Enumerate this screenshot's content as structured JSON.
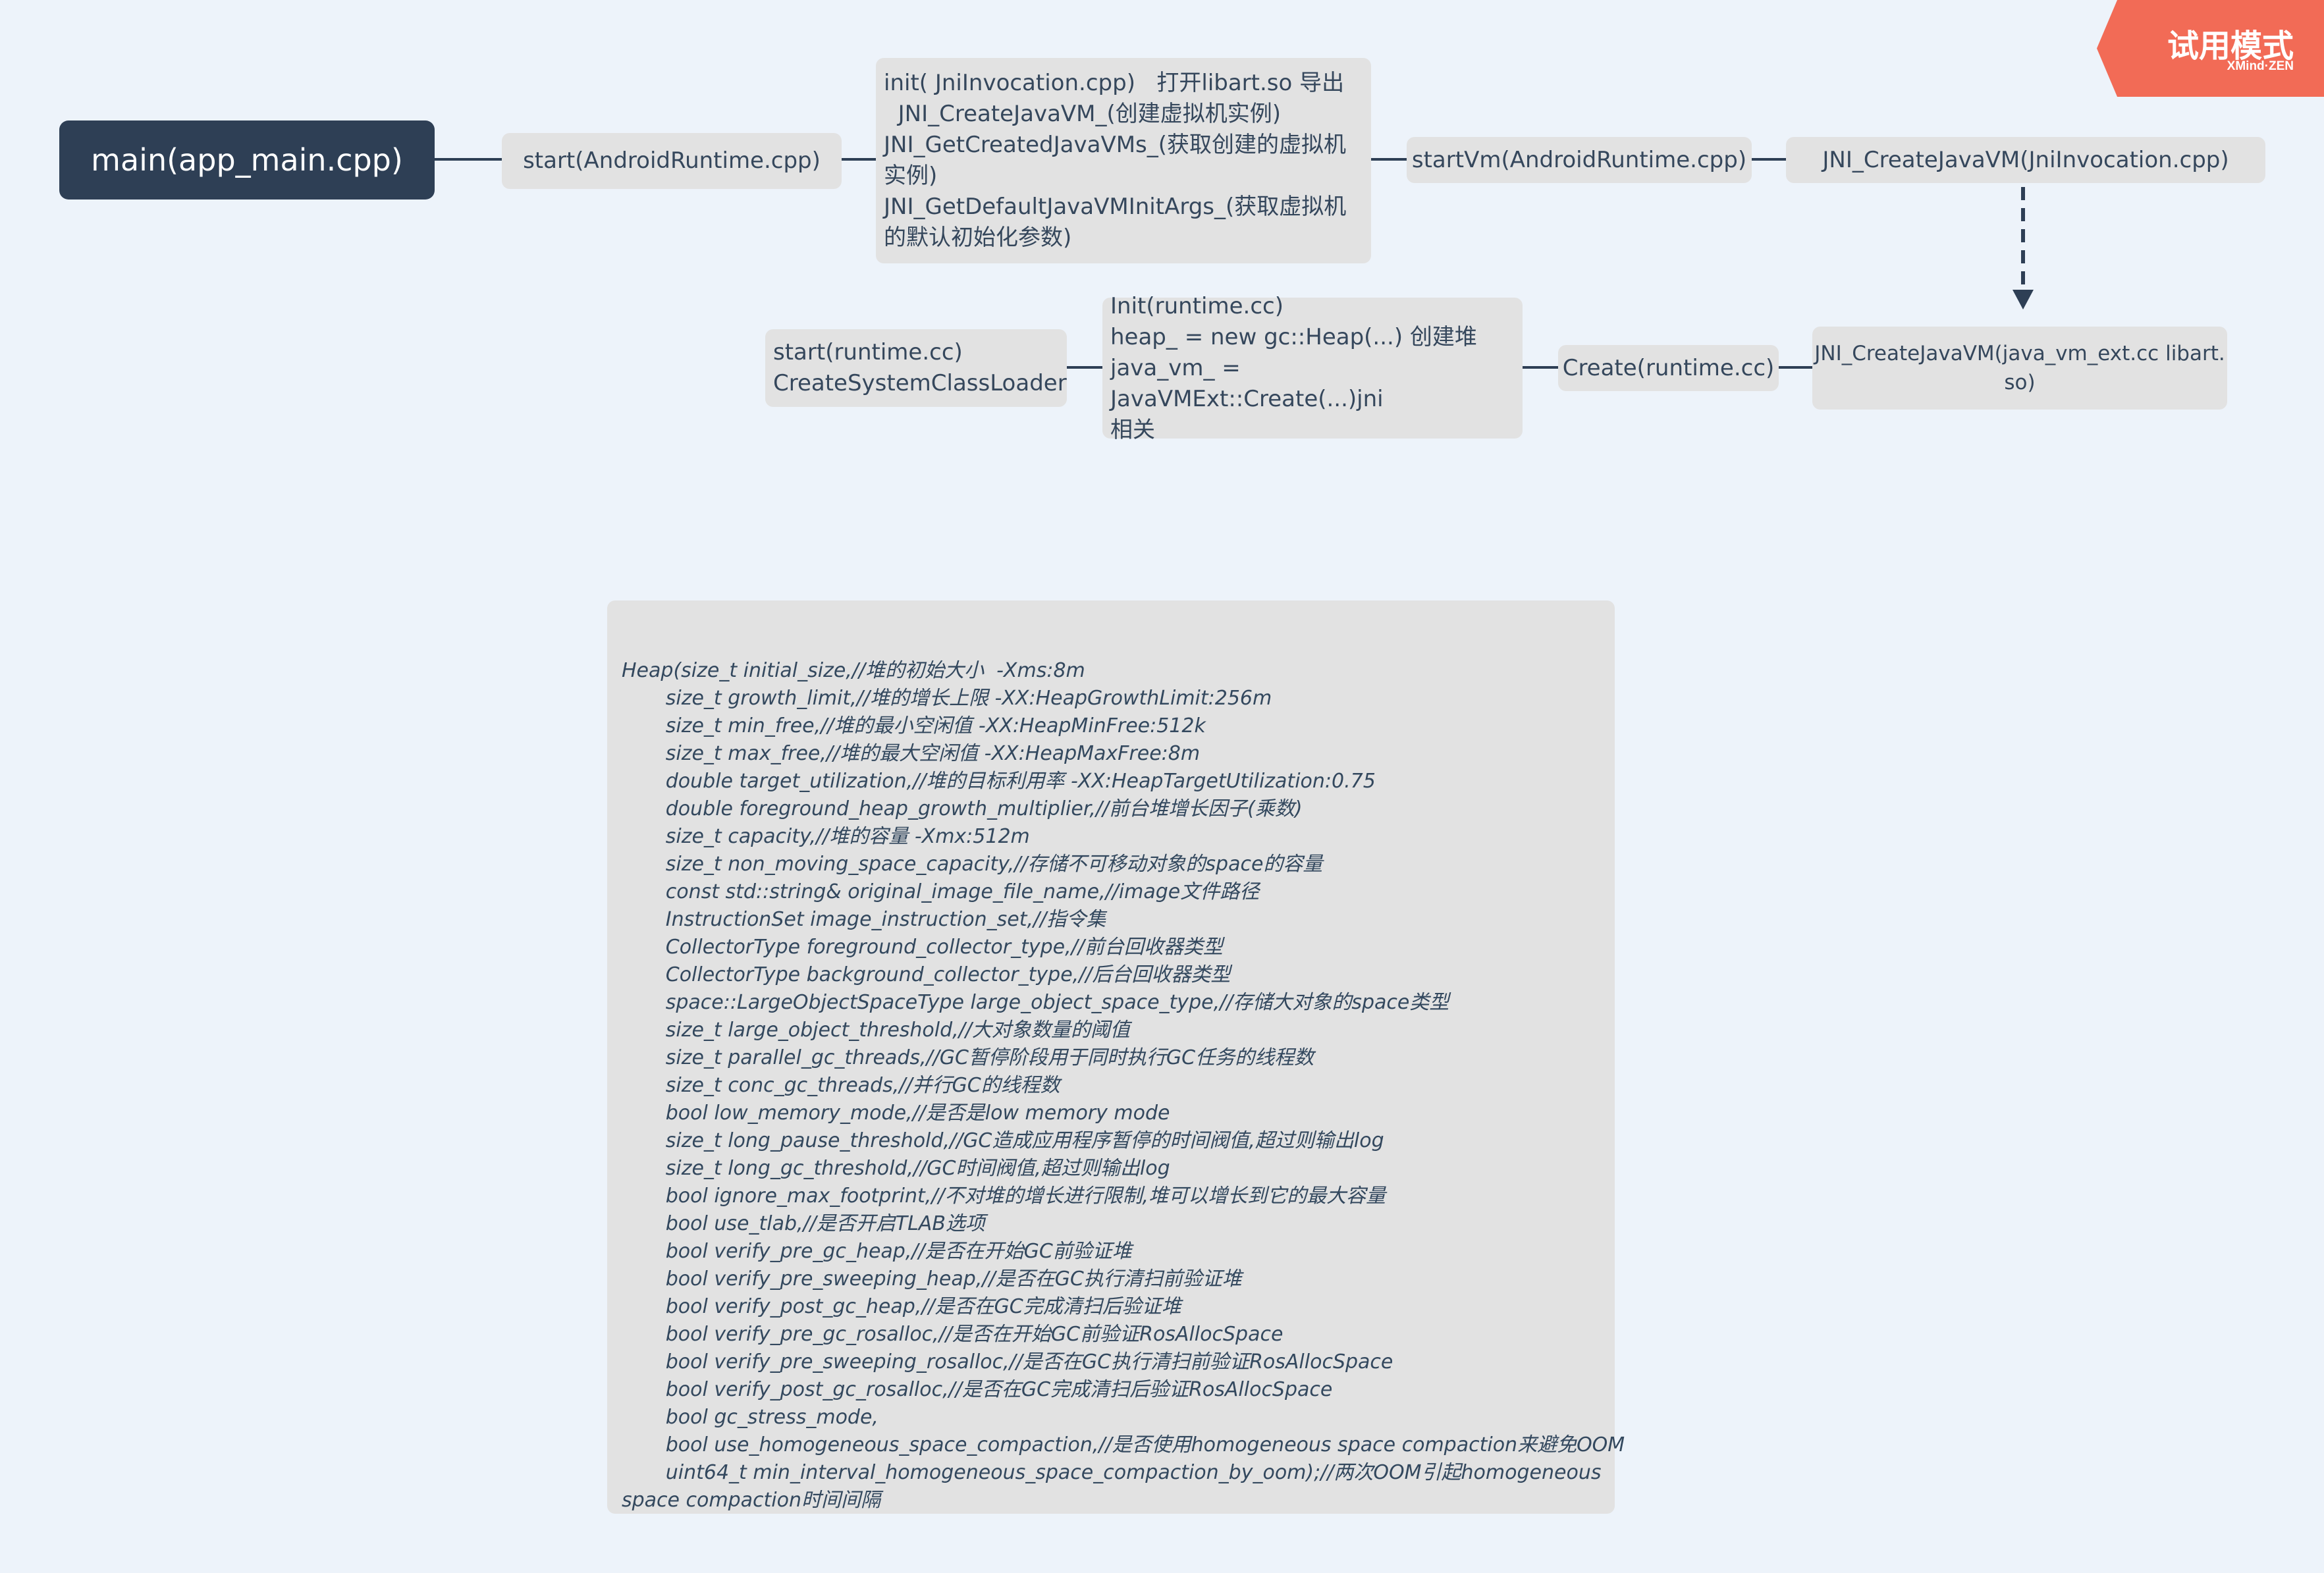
{
  "watermark": {
    "title": "试用模式",
    "subtitle": "XMind·ZEN"
  },
  "nodes": {
    "main": "main(app_main.cpp)",
    "start_android": "start(AndroidRuntime.cpp)",
    "init_jni": "init( JniInvocation.cpp)   打开libart.so 导出\n  JNI_CreateJavaVM_(创建虚拟机实例)\nJNI_GetCreatedJavaVMs_(获取创建的虚拟机\n实例)\nJNI_GetDefaultJavaVMInitArgs_(获取虚拟机\n的默认初始化参数)",
    "start_vm": "startVm(AndroidRuntime.cpp)",
    "jni_create_invocation": "JNI_CreateJavaVM(JniInvocation.cpp)",
    "jni_create_ext": "JNI_CreateJavaVM(java_vm_ext.cc libart.\nso)",
    "create_runtime": "Create(runtime.cc)",
    "init_runtime": "Init(runtime.cc)\nheap_ = new gc::Heap(...) 创建堆\njava_vm_ = JavaVMExt::Create(...)jni\n相关",
    "start_runtime": "start(runtime.cc)\nCreateSystemClassLoader"
  },
  "heap_note": "\nHeap(size_t initial_size,//堆的初始大小  -Xms:8m\n       size_t growth_limit,//堆的增长上限 -XX:HeapGrowthLimit:256m\n       size_t min_free,//堆的最小空闲值 -XX:HeapMinFree:512k\n       size_t max_free,//堆的最大空闲值 -XX:HeapMaxFree:8m\n       double target_utilization,//堆的目标利用率 -XX:HeapTargetUtilization:0.75\n       double foreground_heap_growth_multiplier,//前台堆增长因子(乘数)\n       size_t capacity,//堆的容量 -Xmx:512m\n       size_t non_moving_space_capacity,//存储不可移动对象的space的容量\n       const std::string& original_image_file_name,//image文件路径\n       InstructionSet image_instruction_set,//指令集\n       CollectorType foreground_collector_type,//前台回收器类型\n       CollectorType background_collector_type,//后台回收器类型\n       space::LargeObjectSpaceType large_object_space_type,//存储大对象的space类型\n       size_t large_object_threshold,//大对象数量的阈值\n       size_t parallel_gc_threads,//GC暂停阶段用于同时执行GC任务的线程数\n       size_t conc_gc_threads,//并行GC的线程数\n       bool low_memory_mode,//是否是low memory mode\n       size_t long_pause_threshold,//GC造成应用程序暂停的时间阀值,超过则输出log\n       size_t long_gc_threshold,//GC时间阀值,超过则输出log\n       bool ignore_max_footprint,//不对堆的增长进行限制,堆可以增长到它的最大容量\n       bool use_tlab,//是否开启TLAB选项\n       bool verify_pre_gc_heap,//是否在开始GC前验证堆\n       bool verify_pre_sweeping_heap,//是否在GC执行清扫前验证堆\n       bool verify_post_gc_heap,//是否在GC完成清扫后验证堆\n       bool verify_pre_gc_rosalloc,//是否在开始GC前验证RosAllocSpace\n       bool verify_pre_sweeping_rosalloc,//是否在GC执行清扫前验证RosAllocSpace\n       bool verify_post_gc_rosalloc,//是否在GC完成清扫后验证RosAllocSpace\n       bool gc_stress_mode,\n       bool use_homogeneous_space_compaction,//是否使用homogeneous space compaction来避免OOM\n       uint64_t min_interval_homogeneous_space_compaction_by_oom);//两次OOM引起homogeneous\nspace compaction时间间隔"
}
